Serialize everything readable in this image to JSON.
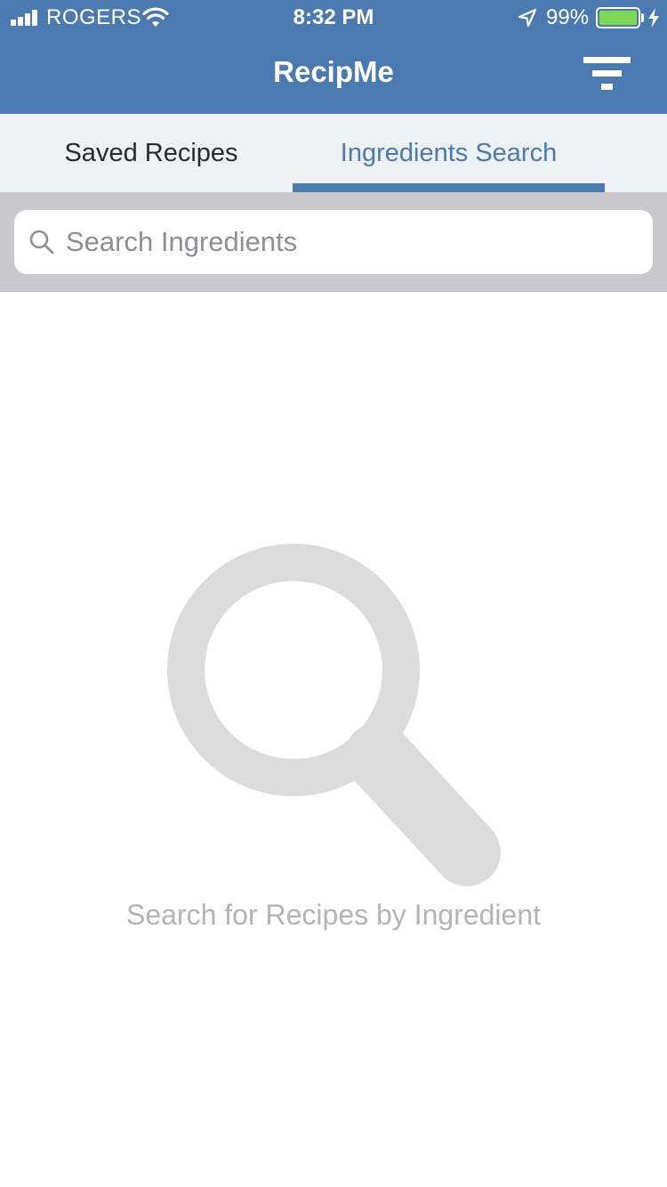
{
  "status_bar": {
    "carrier": "ROGERS",
    "time": "8:32 PM",
    "battery_percent": "99%",
    "battery_level": 0.99,
    "signal_bars_filled": 4,
    "icons": [
      "signal-bars-icon",
      "wifi-icon",
      "location-arrow-icon",
      "battery-icon",
      "charging-bolt-icon"
    ]
  },
  "nav": {
    "title": "RecipMe",
    "filter_icon": "filter-icon"
  },
  "tabs": [
    {
      "label": "Saved Recipes",
      "active": false
    },
    {
      "label": "Ingredients Search",
      "active": true
    }
  ],
  "search": {
    "placeholder": "Search Ingredients",
    "value": "",
    "icon": "search-icon"
  },
  "empty_state": {
    "icon": "magnifier-icon",
    "message": "Search for Recipes by Ingredient"
  },
  "colors": {
    "header_bg": "#4a7ab0",
    "accent": "#4a7ab0",
    "tab_active_text": "#4a7ab0",
    "battery_fill": "#7ed957",
    "empty_icon": "#dcdcdc"
  }
}
